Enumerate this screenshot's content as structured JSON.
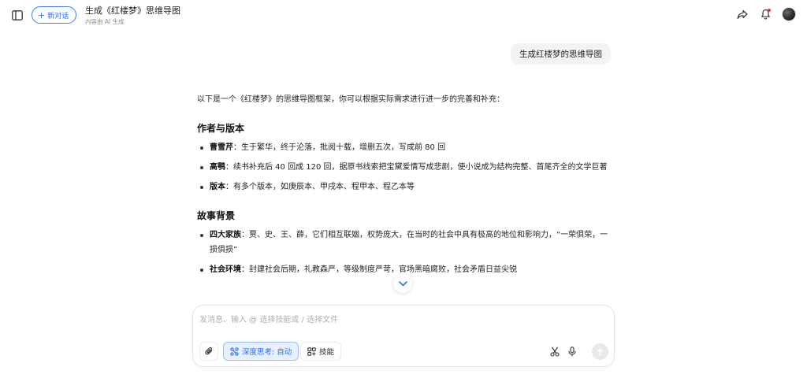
{
  "header": {
    "new_chat_label": "新对话",
    "conversation_title": "生成《红楼梦》思维导图",
    "conversation_subtitle": "内容由 AI 生成"
  },
  "user_message": "生成红楼梦的思维导图",
  "answer": {
    "intro": "以下是一个《红楼梦》的思维导图框架，你可以根据实际需求进行进一步的完善和补充：",
    "sections": [
      {
        "heading": "作者与版本",
        "items": [
          {
            "term": "曹雪芹",
            "text": "：生于繁华，终于沦落，批阅十载，增删五次，写成前 80 回"
          },
          {
            "term": "高鹗",
            "text": "：续书补充后 40 回成 120 回，据原书线索把宝黛爱情写成悲剧，使小说成为结构完整、首尾齐全的文学巨著"
          },
          {
            "term": "版本",
            "text": "：有多个版本，如庚辰本、甲戌本、程甲本、程乙本等"
          }
        ]
      },
      {
        "heading": "故事背景",
        "items": [
          {
            "term": "四大家族",
            "text": "：贾、史、王、薛，它们相互联姻，权势庞大，在当时的社会中具有极高的地位和影响力，“一荣俱荣，一损俱损”"
          },
          {
            "term": "社会环境",
            "text": "：封建社会后期，礼教森严，等级制度严苛，官场黑暗腐败，社会矛盾日益尖锐"
          }
        ]
      }
    ]
  },
  "composer": {
    "placeholder": "发消息、输入 @ 选择技能或 / 选择文件",
    "deep_think_label": "深度思考: 自动",
    "skill_label": "技能"
  },
  "icons": {
    "sidebar_toggle": "sidebar-panel-icon",
    "share": "share-arrow-icon",
    "notifications": "bell-icon",
    "scroll_down": "chevron-down-icon",
    "attach": "paperclip-icon",
    "deep_think": "atom-nodes-icon",
    "skill": "grid-plus-icon",
    "cut": "scissors-icon",
    "mic": "microphone-icon",
    "send": "arrow-up-icon"
  },
  "colors": {
    "accent": "#2f6fe8",
    "accent_bg": "#e7f0fe",
    "notification_dot": "#e53935",
    "bubble_bg": "#f3f3f4"
  }
}
